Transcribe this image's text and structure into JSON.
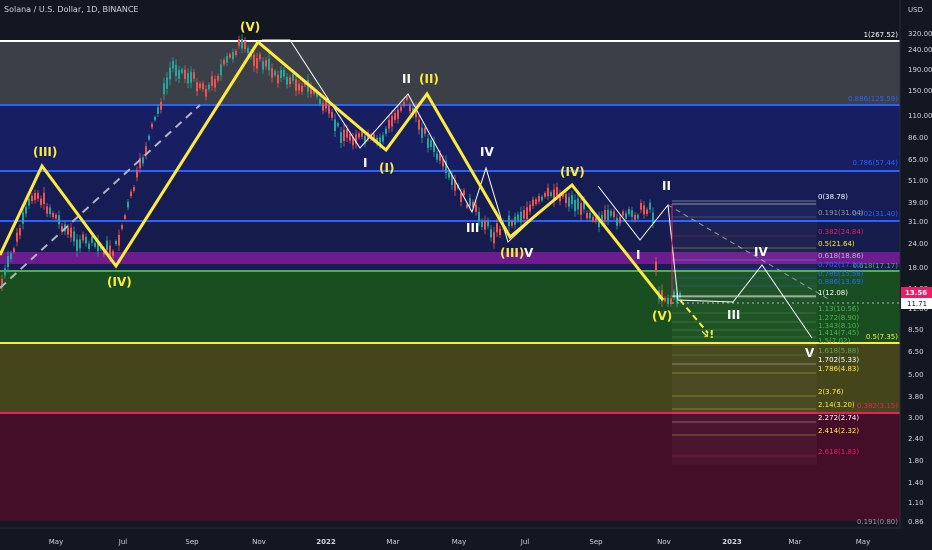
{
  "header": {
    "title": "Solana / U.S. Dollar, 1D, BINANCE"
  },
  "price_axis": {
    "currency": "USD",
    "ticks": [
      "320.00",
      "240.00",
      "190.00",
      "150.00",
      "110.00",
      "86.00",
      "65.00",
      "51.00",
      "39.00",
      "31.00",
      "24.00",
      "18.00",
      "14.00",
      "11.00",
      "8.50",
      "6.50",
      "5.00",
      "3.80",
      "3.00",
      "2.40",
      "1.80",
      "1.40",
      "1.10",
      "0.86"
    ],
    "last_price": "13.56",
    "cross_price": "11.71"
  },
  "time_axis": {
    "ticks": [
      "May",
      "Jul",
      "Sep",
      "Nov",
      "2022",
      "Mar",
      "May",
      "Jul",
      "Sep",
      "Nov",
      "2023",
      "Mar",
      "May"
    ]
  },
  "colors": {
    "background": "#131722",
    "wave": "#ffeb3b",
    "blue_line": "#2962ff",
    "green_line": "#4caf50",
    "purple_band": "#7b1fa2",
    "red_band": "#880e4f",
    "white": "#ffffff"
  },
  "chart_data": {
    "type": "line",
    "title": "Solana / U.S. Dollar, 1D, BINANCE",
    "y_scale": "log",
    "ylim": [
      0.8,
      340
    ],
    "price_path": {
      "x": [
        "2021-04-10",
        "2021-05-10",
        "2021-06-15",
        "2021-07-20",
        "2021-08-15",
        "2021-09-09",
        "2021-10-10",
        "2021-11-06",
        "2021-12-10",
        "2022-01-10",
        "2022-02-05",
        "2022-03-10",
        "2022-04-02",
        "2022-05-12",
        "2022-06-18",
        "2022-08-12",
        "2022-09-20",
        "2022-10-15",
        "2022-11-05",
        "2022-11-09",
        "2022-11-20",
        "2022-12-01"
      ],
      "y": [
        14,
        45,
        25,
        22,
        70,
        200,
        150,
        255,
        180,
        150,
        88,
        80,
        135,
        50,
        27,
        45,
        32,
        33,
        38,
        14,
        12,
        13.56
      ]
    },
    "elliott_waves_yellow": {
      "labels": [
        "(III)",
        "(IV)",
        "(V)",
        "(I)",
        "(II)",
        "(III)",
        "(IV)",
        "(V)"
      ],
      "points": [
        {
          "x": "2021-05-10",
          "y": 56,
          "label": "(III)"
        },
        {
          "x": "2021-06-28",
          "y": 22,
          "label": "(IV)"
        },
        {
          "x": "2021-11-06",
          "y": 260,
          "label": "(V)"
        },
        {
          "x": "2022-02-20",
          "y": 72,
          "label": "(I)"
        },
        {
          "x": "2022-04-02",
          "y": 140,
          "label": "(II)"
        },
        {
          "x": "2022-06-18",
          "y": 25,
          "label": "(III)"
        },
        {
          "x": "2022-08-12",
          "y": 46,
          "label": "(IV)"
        },
        {
          "x": "2022-11-09",
          "y": 11.5,
          "label": "(V)"
        }
      ]
    },
    "elliott_waves_white": {
      "labels": [
        "I",
        "II",
        "III",
        "IV",
        "V",
        "I",
        "II",
        "III",
        "IV",
        "V"
      ]
    },
    "fib_levels_right": [
      {
        "label": "1(267.52)",
        "value": 267.52,
        "color": "#ffffff"
      },
      {
        "label": "0.886(125.59)",
        "value": 125.59,
        "color": "#2962ff"
      },
      {
        "label": "0.786(57.44)",
        "value": 57.44,
        "color": "#2962ff"
      },
      {
        "label": "0.702(31.40)",
        "value": 31.4,
        "color": "#2962ff"
      },
      {
        "label": "0.618(17.17)",
        "value": 17.17,
        "color": "#4caf50"
      },
      {
        "label": "0.5(7.35)",
        "value": 7.35,
        "color": "#ffeb3b"
      },
      {
        "label": "0.382(3.15)",
        "value": 3.15,
        "color": "#e91e63"
      },
      {
        "label": "0.191(0.80)",
        "value": 0.8,
        "color": "#9598a1"
      }
    ],
    "fib_levels_projection": [
      {
        "label": "0(38.78)",
        "value": 38.78,
        "color": "#ffffff"
      },
      {
        "label": "0.191(31.04)",
        "value": 31.04,
        "color": "#9598a1"
      },
      {
        "label": "0.382(24.84)",
        "value": 24.84,
        "color": "#e91e63"
      },
      {
        "label": "0.5(21.64)",
        "value": 21.64,
        "color": "#ffeb3b"
      },
      {
        "label": "0.618(18.86)",
        "value": 18.86,
        "color": "#b2b5be"
      },
      {
        "label": "0.702(17.10)",
        "value": 17.1,
        "color": "#2962ff"
      },
      {
        "label": "0.786(15.58)",
        "value": 15.58,
        "color": "#2962ff"
      },
      {
        "label": "0.886(13.69)",
        "value": 13.69,
        "color": "#2962ff"
      },
      {
        "label": "1(12.08)",
        "value": 12.08,
        "color": "#ffffff"
      },
      {
        "label": "1.13(10.56)",
        "value": 10.56,
        "color": "#4caf50"
      },
      {
        "label": "1.272(8.90)",
        "value": 8.9,
        "color": "#4caf50"
      },
      {
        "label": "1.343(8.10)",
        "value": 8.1,
        "color": "#4caf50"
      },
      {
        "label": "1.414(7.45)",
        "value": 7.45,
        "color": "#4caf50"
      },
      {
        "label": "1.5(7.02)",
        "value": 7.02,
        "color": "#4caf50"
      },
      {
        "label": "1.618(5.88)",
        "value": 5.88,
        "color": "#4caf50"
      },
      {
        "label": "1.702(5.33)",
        "value": 5.33,
        "color": "#ffffff"
      },
      {
        "label": "1.786(4.83)",
        "value": 4.83,
        "color": "#ffeb3b"
      },
      {
        "label": "2(3.76)",
        "value": 3.76,
        "color": "#ffeb3b"
      },
      {
        "label": "2.14(3.20)",
        "value": 3.2,
        "color": "#ffeb3b"
      },
      {
        "label": "2.272(2.74)",
        "value": 2.74,
        "color": "#ffffff"
      },
      {
        "label": "2.414(2.32)",
        "value": 2.32,
        "color": "#ffeb3b"
      },
      {
        "label": "2.618(1.83)",
        "value": 1.83,
        "color": "#e91e63"
      }
    ],
    "grid": false
  }
}
